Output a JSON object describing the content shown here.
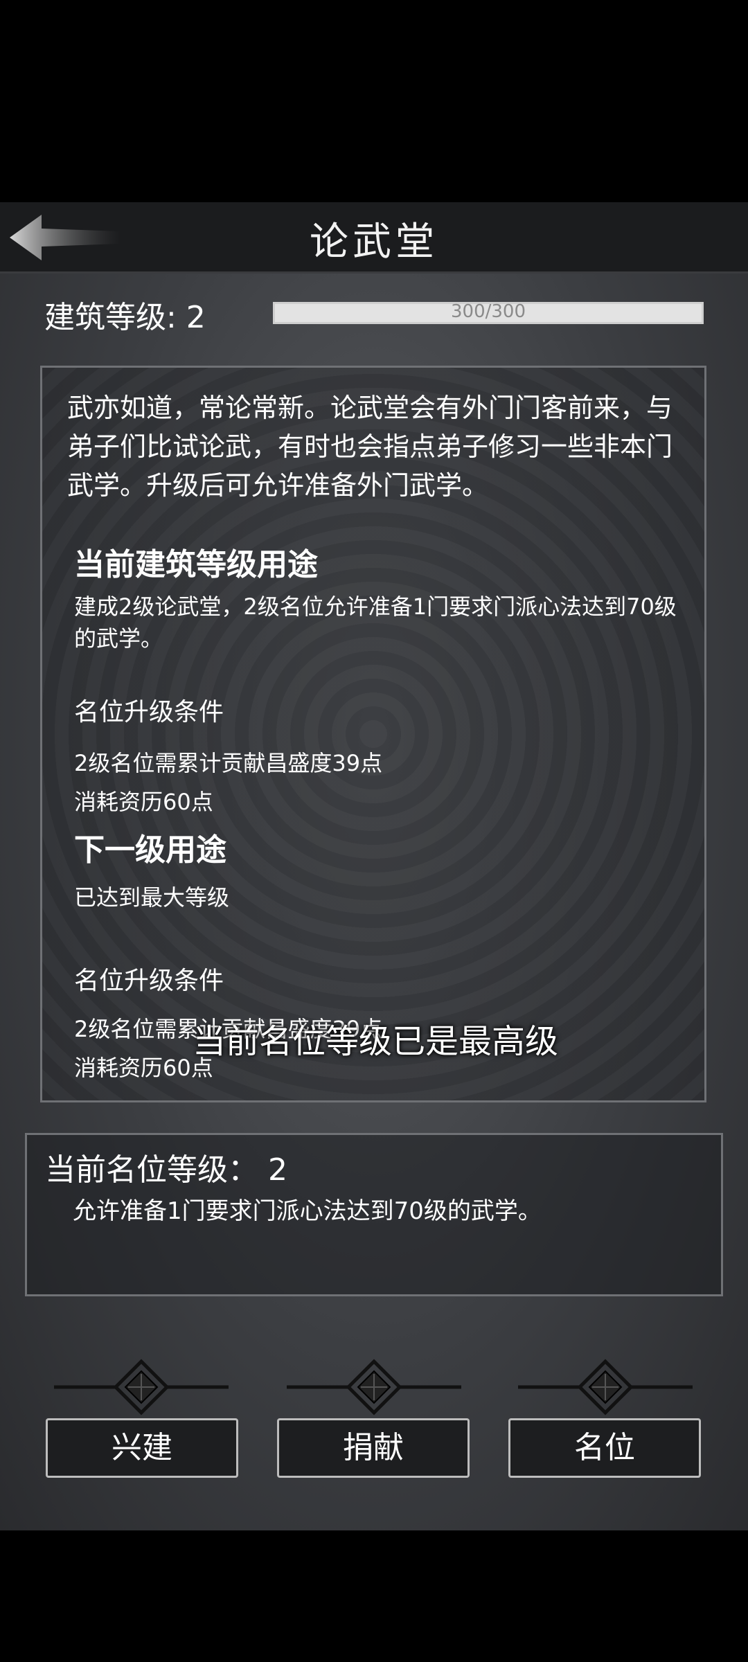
{
  "header": {
    "title": "论武堂",
    "back_icon": "arrow-left-icon"
  },
  "building": {
    "level_label": "建筑等级: 2",
    "progress_text": "300/300",
    "progress_fraction": 1.0
  },
  "description": "武亦如道，常论常新。论武堂会有外门门客前来，与弟子们比试论武，有时也会指点弟子修习一些非本门武学。升级后可允许准备外门武学。",
  "current_use": {
    "heading": "当前建筑等级用途",
    "body": "建成2级论武堂，2级名位允许准备1门要求门派心法达到70级的武学。",
    "conditions_heading": "名位升级条件",
    "condition_1": "2级名位需累计贡献昌盛度39点",
    "condition_2": "消耗资历60点"
  },
  "next_use": {
    "heading": "下一级用途",
    "body": "已达到最大等级",
    "conditions_heading": "名位升级条件",
    "condition_1": "2级名位需累计贡献昌盛度39点",
    "condition_2": "消耗资历60点"
  },
  "overlay_message": "当前名位等级已是最高级",
  "rank": {
    "title": "当前名位等级：  2",
    "body": "允许准备1门要求门派心法达到70级的武学。"
  },
  "buttons": {
    "build": "兴建",
    "donate": "捐献",
    "rank": "名位"
  },
  "colors": {
    "background": "#3c3e42",
    "topbar": "#1b1c1e",
    "border": "#6f7175"
  }
}
